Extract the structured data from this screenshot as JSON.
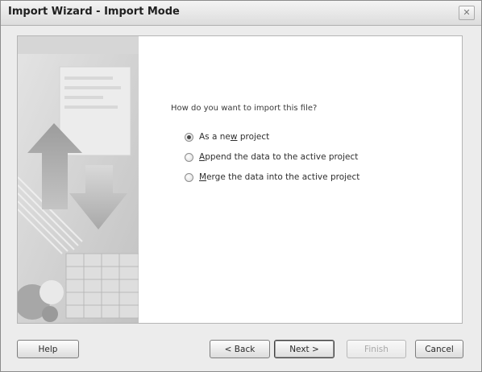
{
  "window": {
    "title": "Import Wizard - Import Mode",
    "close_icon": "close-icon"
  },
  "main": {
    "question": "How do you want to import this file?",
    "options": [
      {
        "pre": "As a ne",
        "mnemonic": "w",
        "post": " project",
        "checked": true
      },
      {
        "pre": "",
        "mnemonic": "A",
        "post": "ppend the data to the active project",
        "checked": false
      },
      {
        "pre": "",
        "mnemonic": "M",
        "post": "erge the data into the active project",
        "checked": false
      }
    ],
    "selected_option": "As a new project"
  },
  "buttons": {
    "help": "Help",
    "back": "< Back",
    "next": "Next >",
    "finish": "Finish",
    "cancel": "Cancel"
  },
  "colors": {
    "art_base": "#c9c9c9",
    "art_dark": "#8a8a8a",
    "art_light": "#e6e6e6"
  }
}
